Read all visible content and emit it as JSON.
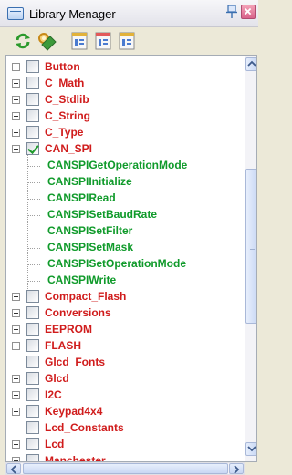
{
  "window": {
    "title": "Library Menager"
  },
  "toolbar": {
    "buttons": [
      {
        "name": "refresh-icon"
      },
      {
        "name": "search-icon"
      },
      {
        "name": "document-icon"
      },
      {
        "name": "document-icon"
      },
      {
        "name": "document-icon"
      }
    ]
  },
  "tree": {
    "items": [
      {
        "label": "Button",
        "checked": false,
        "expander": "plus",
        "level": 0,
        "color": "red"
      },
      {
        "label": "C_Math",
        "checked": false,
        "expander": "plus",
        "level": 0,
        "color": "red"
      },
      {
        "label": "C_Stdlib",
        "checked": false,
        "expander": "plus",
        "level": 0,
        "color": "red"
      },
      {
        "label": "C_String",
        "checked": false,
        "expander": "plus",
        "level": 0,
        "color": "red"
      },
      {
        "label": "C_Type",
        "checked": false,
        "expander": "plus",
        "level": 0,
        "color": "red"
      },
      {
        "label": "CAN_SPI",
        "checked": true,
        "expander": "minus",
        "level": 0,
        "color": "red"
      },
      {
        "label": "CANSPIGetOperationMode",
        "level": 1,
        "color": "green"
      },
      {
        "label": "CANSPIInitialize",
        "level": 1,
        "color": "green"
      },
      {
        "label": "CANSPIRead",
        "level": 1,
        "color": "green"
      },
      {
        "label": "CANSPISetBaudRate",
        "level": 1,
        "color": "green"
      },
      {
        "label": "CANSPISetFilter",
        "level": 1,
        "color": "green"
      },
      {
        "label": "CANSPISetMask",
        "level": 1,
        "color": "green"
      },
      {
        "label": "CANSPISetOperationMode",
        "level": 1,
        "color": "green"
      },
      {
        "label": "CANSPIWrite",
        "level": 1,
        "color": "green"
      },
      {
        "label": "Compact_Flash",
        "checked": false,
        "expander": "plus",
        "level": 0,
        "color": "red"
      },
      {
        "label": "Conversions",
        "checked": false,
        "expander": "plus",
        "level": 0,
        "color": "red"
      },
      {
        "label": "EEPROM",
        "checked": false,
        "expander": "plus",
        "level": 0,
        "color": "red"
      },
      {
        "label": "FLASH",
        "checked": false,
        "expander": "plus",
        "level": 0,
        "color": "red"
      },
      {
        "label": "Glcd_Fonts",
        "checked": false,
        "expander": "none",
        "level": 0,
        "color": "red"
      },
      {
        "label": "Glcd",
        "checked": false,
        "expander": "plus",
        "level": 0,
        "color": "red"
      },
      {
        "label": "I2C",
        "checked": false,
        "expander": "plus",
        "level": 0,
        "color": "red"
      },
      {
        "label": "Keypad4x4",
        "checked": false,
        "expander": "plus",
        "level": 0,
        "color": "red"
      },
      {
        "label": "Lcd_Constants",
        "checked": false,
        "expander": "none",
        "level": 0,
        "color": "red"
      },
      {
        "label": "Lcd",
        "checked": false,
        "expander": "plus",
        "level": 0,
        "color": "red"
      },
      {
        "label": "Manchester",
        "checked": false,
        "expander": "plus",
        "level": 0,
        "color": "red"
      }
    ]
  },
  "colors": {
    "red_label": "#d01c1c",
    "green_label": "#0f9a2a"
  }
}
